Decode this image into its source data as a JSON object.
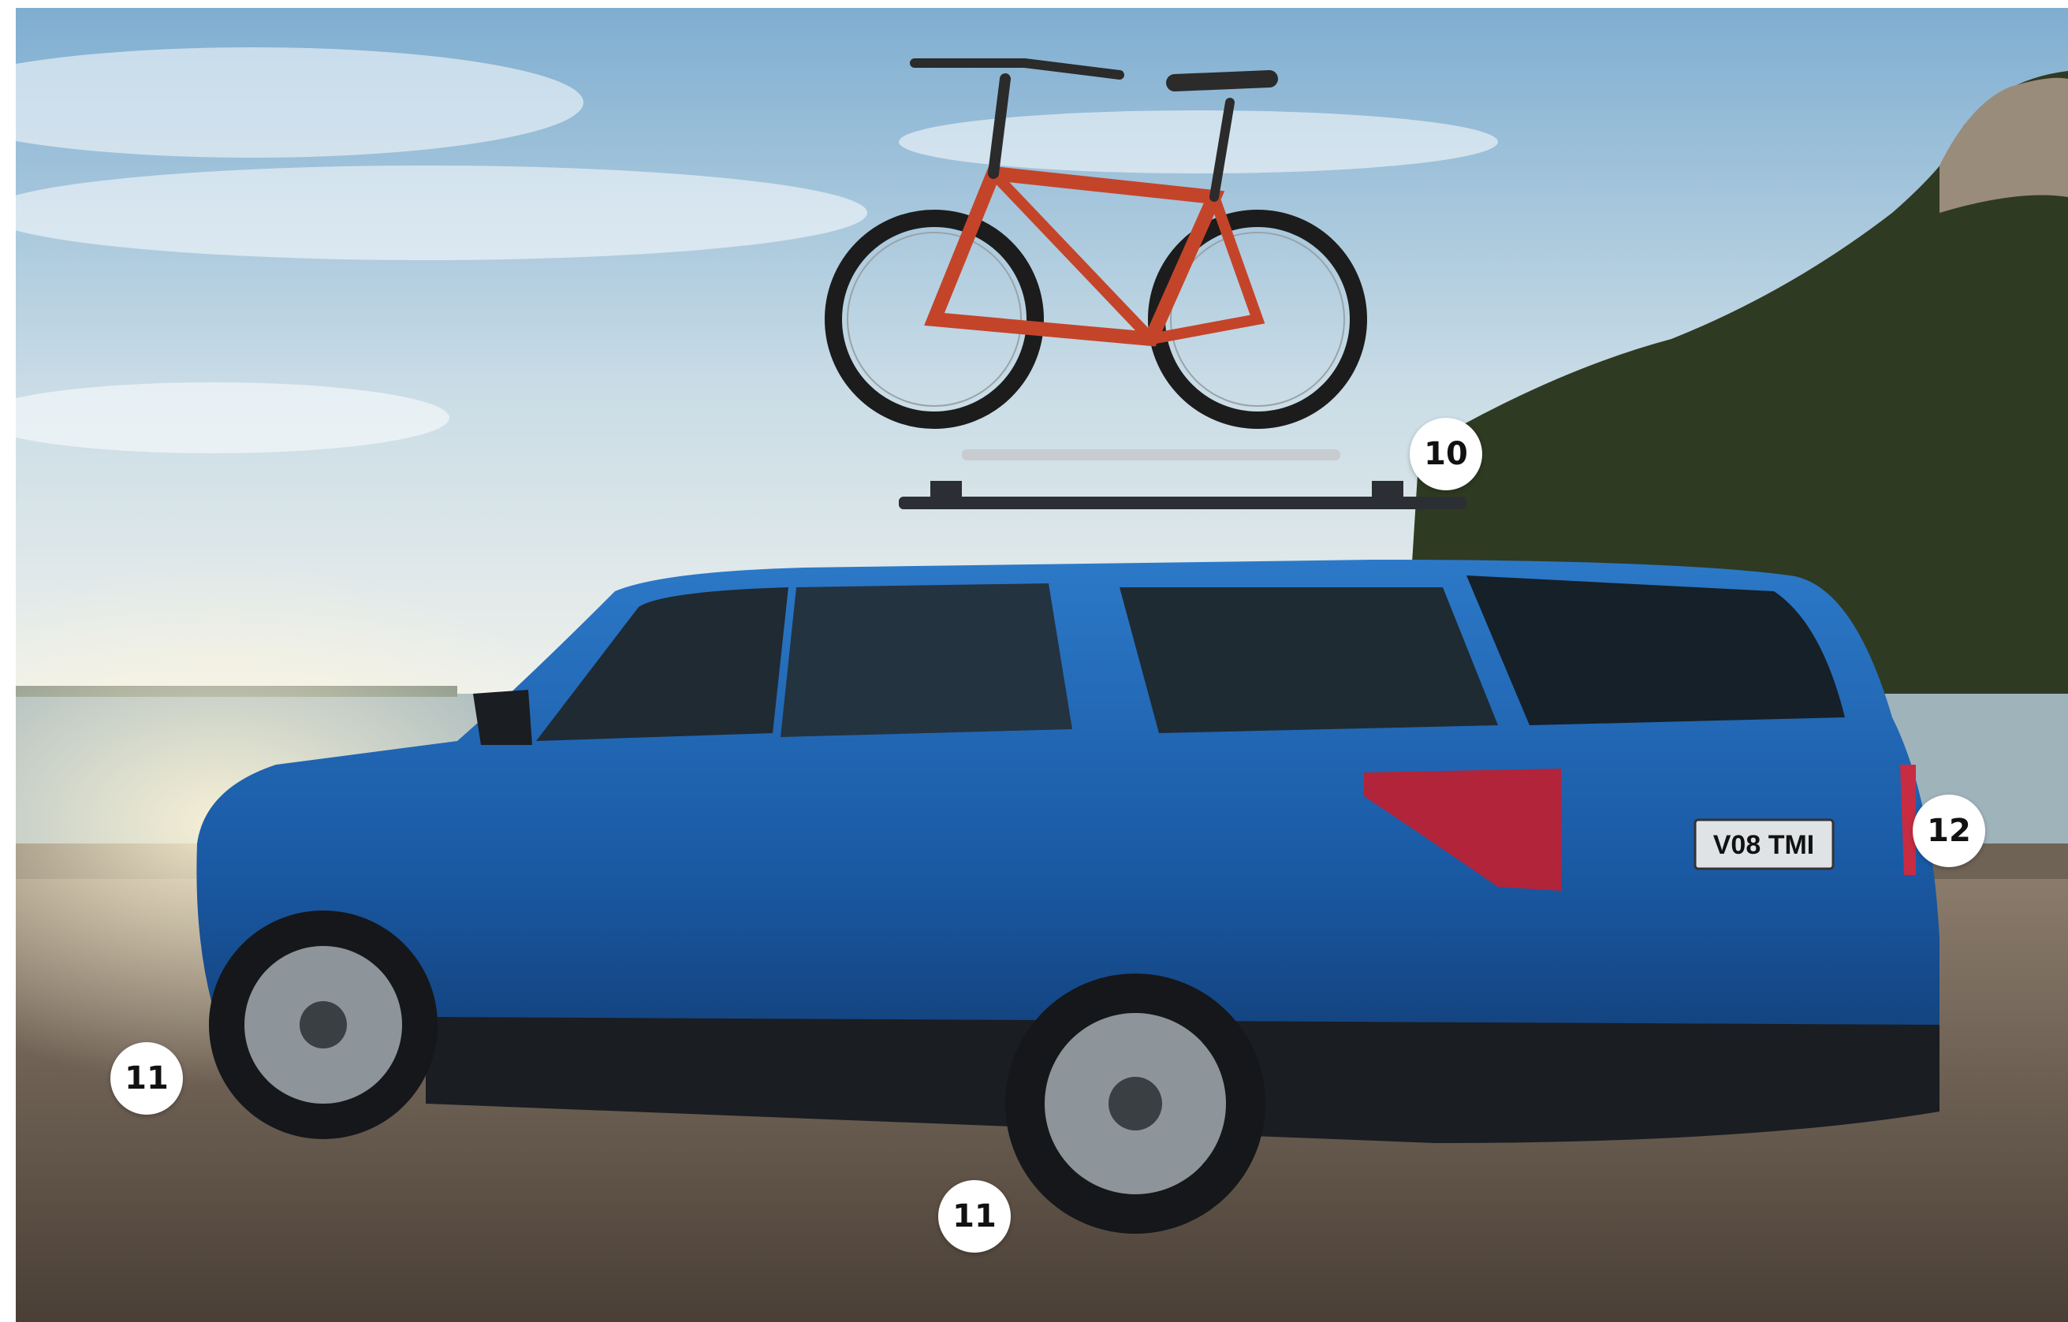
{
  "scene": {
    "description_tags": [
      "suv",
      "bicycle",
      "roof-rack",
      "coast",
      "mountain",
      "sky"
    ],
    "colors": {
      "car_body": "#1f5fae",
      "bike_frame": "#c4442a",
      "sky_top": "#8fb8d6",
      "sky_bottom": "#dfe7ea",
      "ground": "#6b5d50",
      "mountain": "#2f3a22",
      "sea": "#9fb3bb"
    }
  },
  "vehicle": {
    "plate_text": "V08 TMI"
  },
  "callouts": [
    {
      "id": "callout-10",
      "label": "10"
    },
    {
      "id": "callout-11-front",
      "label": "11"
    },
    {
      "id": "callout-11-rear",
      "label": "11"
    },
    {
      "id": "callout-12",
      "label": "12"
    }
  ]
}
